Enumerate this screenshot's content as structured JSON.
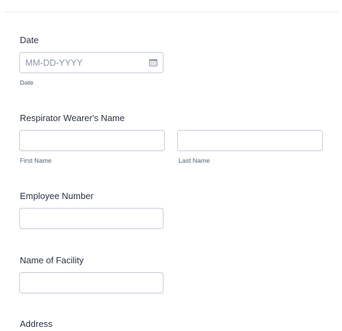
{
  "form": {
    "date": {
      "label": "Date",
      "placeholder": "MM-DD-YYYY",
      "sublabel": "Date"
    },
    "wearer_name": {
      "label": "Respirator Wearer's Name",
      "first_sublabel": "First Name",
      "last_sublabel": "Last Name"
    },
    "employee_number": {
      "label": "Employee Number"
    },
    "facility": {
      "label": "Name of Facility"
    },
    "address": {
      "label": "Address"
    }
  },
  "icons": {
    "date_picker": "calendar-icon"
  }
}
